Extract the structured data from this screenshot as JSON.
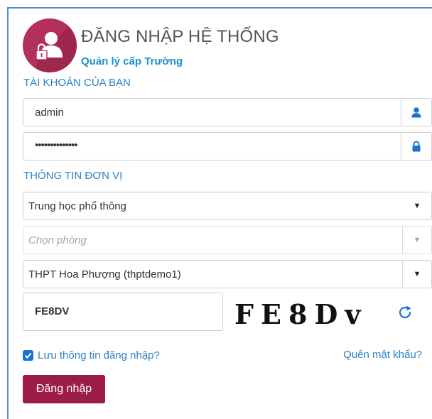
{
  "header": {
    "title": "ĐĂNG NHẬP HỆ THỐNG",
    "subtitle": "Quản lý cấp Trường",
    "icon": "user-lock-icon"
  },
  "account_section": {
    "label": "TÀI KHOẢN CỦA BẠN",
    "username_value": "admin",
    "password_value": "••••••••••••••",
    "username_icon": "user-icon",
    "password_icon": "lock-icon"
  },
  "unit_section": {
    "label": "THÔNG TIN ĐƠN VỊ",
    "level_selected": "Trung học phổ thông",
    "room_placeholder": "Chọn phòng",
    "school_selected": "THPT Hoa Phượng (thptdemo1)"
  },
  "captcha": {
    "input_value": "FE8DV",
    "image_text": "FE8Dv",
    "refresh_icon": "refresh-icon"
  },
  "remember_label": "Lưu thông tin đăng nhập?",
  "remember_checked": true,
  "forgot_link": "Quên mật khẩu?",
  "login_button": "Đăng nhập",
  "colors": {
    "brand": "#9b1d46",
    "accent": "#2b82c6",
    "avatar": "#b4305a"
  }
}
